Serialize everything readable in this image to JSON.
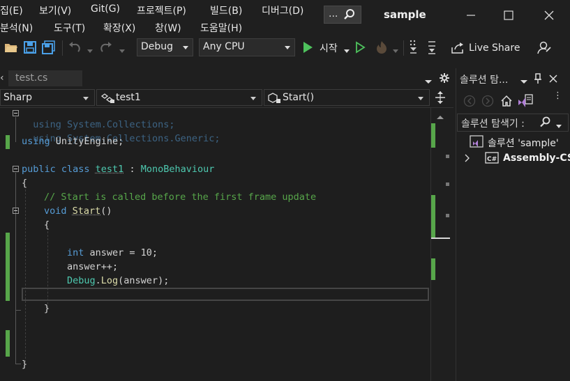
{
  "menubar": {
    "items": [
      "집(E)",
      "보기(V)",
      "Git(G)",
      "프로젝트(P)",
      "빌드(B)",
      "디버그(D)",
      "분석(N)",
      "도구(T)",
      "확장(X)",
      "창(W)",
      "도움말(H)"
    ]
  },
  "search": {
    "label": "..."
  },
  "window": {
    "title": "sample"
  },
  "toolbar": {
    "config": "Debug",
    "platform": "Any CPU",
    "start_label": "시작",
    "live_share_label": "Live Share"
  },
  "editor": {
    "tab_label": "test.cs",
    "nav": {
      "project": "Sharp",
      "class": "test1",
      "member": "Start()"
    },
    "lines": {
      "l1": "using System.Collections;",
      "l2": "using System.Collections.Generic;",
      "l3": "using",
      "l3b": " UnityEngine;",
      "l5_kw": "public class ",
      "l5_name": "test1",
      "l5_sep": " : ",
      "l5_base": "MonoBehaviour",
      "l6": "{",
      "l7": "// Start is called before the first frame update",
      "l8_kw": "void ",
      "l8_fn": "Start",
      "l8_rest": "()",
      "l9": "{",
      "l11_kw": "int",
      "l11_rest": " answer = 10;",
      "l12": "answer++;",
      "l13_ty": "Debug",
      "l13_dot": ".",
      "l13_fn": "Log",
      "l13_rest": "(answer);",
      "l15": "}",
      "l19": "}"
    }
  },
  "solution_explorer": {
    "title": "솔루션 탐...",
    "search_placeholder": "솔루션 탐색기 :",
    "root_label": "솔루션 'sample'",
    "assembly_label": "Assembly-CS"
  },
  "colors": {
    "background": "#1f1f1f",
    "editor_bg": "#1e1e1e",
    "keyword": "#569cd6",
    "type": "#4ec9b0",
    "comment": "#57a64a",
    "function": "#dcdcaa",
    "play_green": "#4ec25d",
    "vs_purple": "#b180d7"
  }
}
